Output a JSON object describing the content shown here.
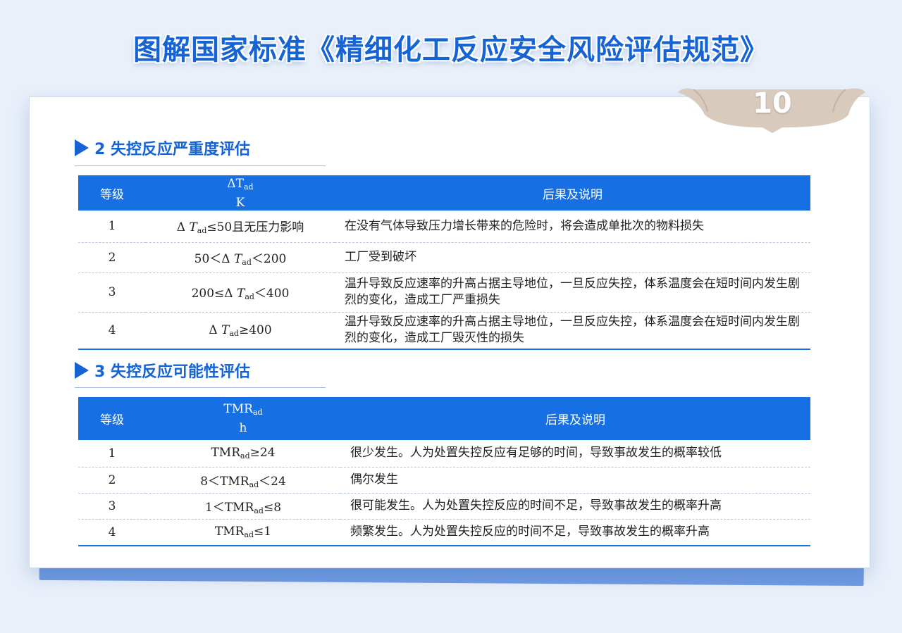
{
  "title": "图解国家标准《精细化工反应安全风险评估规范》",
  "page_number": "10",
  "section_severity": {
    "heading": "2  失控反应严重度评估",
    "header": {
      "level": "等级",
      "param_top": "ΔT",
      "param_sub": "ad",
      "param_unit": "K",
      "desc": "后果及说明"
    },
    "rows": [
      {
        "level": "1",
        "pre": "Δ ",
        "sym": "T",
        "sub": "ad",
        "post": "≤50且无压力影响",
        "desc": "在没有气体导致压力增长带来的危险时，将会造成单批次的物料损失"
      },
      {
        "level": "2",
        "pre": "50＜Δ ",
        "sym": "T",
        "sub": "ad",
        "post": "＜200",
        "desc": "工厂受到破坏"
      },
      {
        "level": "3",
        "pre": "200≤Δ ",
        "sym": "T",
        "sub": "ad",
        "post": "＜400",
        "desc": "温升导致反应速率的升高占据主导地位，一旦反应失控，体系温度会在短时间内发生剧烈的变化，造成工厂严重损失"
      },
      {
        "level": "4",
        "pre": "Δ ",
        "sym": "T",
        "sub": "ad",
        "post": "≥400",
        "desc": "温升导致反应速率的升高占据主导地位，一旦反应失控，体系温度会在短时间内发生剧烈的变化，造成工厂毁灭性的损失"
      }
    ]
  },
  "section_probability": {
    "heading": "3  失控反应可能性评估",
    "header": {
      "level": "等级",
      "param_top": "TMR",
      "param_sub": "ad",
      "param_unit": "h",
      "desc": "后果及说明"
    },
    "rows": [
      {
        "level": "1",
        "pre": "",
        "sym": "TMR",
        "sub": "ad",
        "post": "≥24",
        "desc": "很少发生。人为处置失控反应有足够的时间，导致事故发生的概率较低"
      },
      {
        "level": "2",
        "pre": "8＜",
        "sym": "TMR",
        "sub": "ad",
        "post": "＜24",
        "desc": "偶尔发生"
      },
      {
        "level": "3",
        "pre": "1＜",
        "sym": "TMR",
        "sub": "ad",
        "post": "≤8",
        "desc": "很可能发生。人为处置失控反应的时间不足，导致事故发生的概率升高"
      },
      {
        "level": "4",
        "pre": "",
        "sym": "TMR",
        "sub": "ad",
        "post": "≤1",
        "desc": "频繁发生。人为处置失控反应的时间不足，导致事故发生的概率升高"
      }
    ]
  },
  "colors": {
    "accent": "#1664d4",
    "table_header": "#1670e3",
    "background": "#e9f0fa",
    "page_tab": "#d8cbbd"
  }
}
